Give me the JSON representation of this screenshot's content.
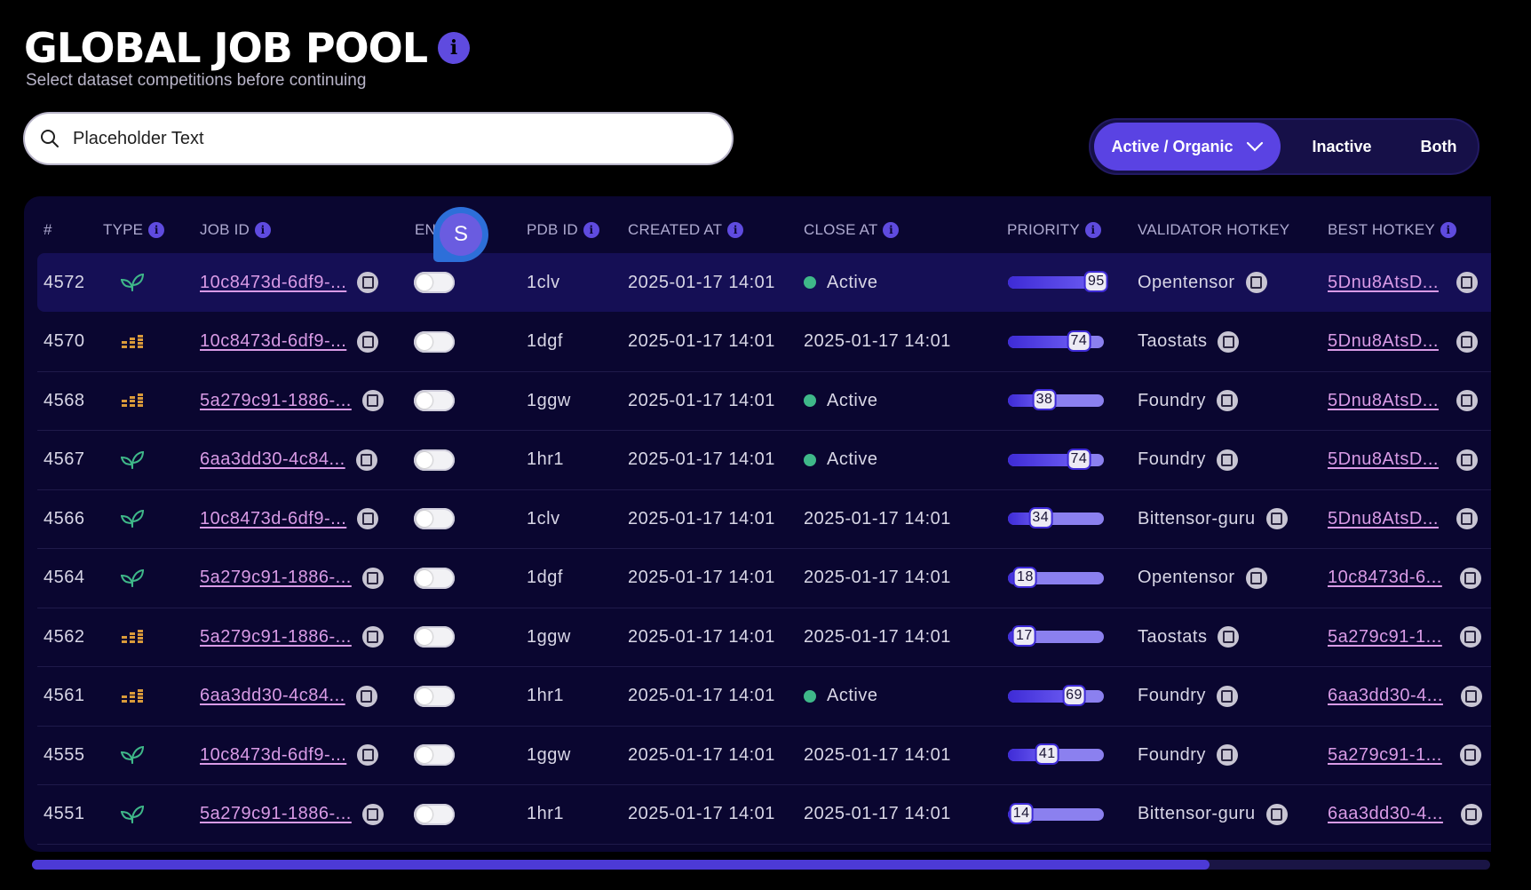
{
  "header": {
    "title": "GLOBAL JOB POOL",
    "subtitle": "Select dataset competitions before continuing"
  },
  "search": {
    "placeholder": "Placeholder Text",
    "value": ""
  },
  "filter": {
    "options": [
      "Active / Organic",
      "Inactive",
      "Both"
    ],
    "selected": "Active / Organic"
  },
  "table": {
    "columns": [
      "#",
      "TYPE",
      "JOB ID",
      "EN",
      "PDB ID",
      "CREATED AT",
      "CLOSE AT",
      "PRIORITY",
      "VALIDATOR HOTKEY",
      "BEST HOTKEY"
    ],
    "rows": [
      {
        "num": "4572",
        "type": "leaf-icon",
        "job_id": "10c8473d-6df9-...",
        "pdb": "1clv",
        "created": "2025-01-17 14:01",
        "close": "Active",
        "active": true,
        "priority": 95,
        "priority_label": "95",
        "validator": "Opentensor",
        "best": "5Dnu8AtsD..."
      },
      {
        "num": "4570",
        "type": "bars-icon",
        "job_id": "10c8473d-6df9-...",
        "pdb": "1dgf",
        "created": "2025-01-17 14:01",
        "close": "2025-01-17 14:01",
        "active": false,
        "priority": 74,
        "priority_label": "74",
        "validator": "Taostats",
        "best": "5Dnu8AtsD..."
      },
      {
        "num": "4568",
        "type": "bars-icon",
        "job_id": "5a279c91-1886-...",
        "pdb": "1ggw",
        "created": "2025-01-17 14:01",
        "close": "Active",
        "active": true,
        "priority": 38,
        "priority_label": "38",
        "validator": "Foundry",
        "best": "5Dnu8AtsD..."
      },
      {
        "num": "4567",
        "type": "leaf-icon",
        "job_id": "6aa3dd30-4c84...",
        "pdb": "1hr1",
        "created": "2025-01-17 14:01",
        "close": "Active",
        "active": true,
        "priority": 74,
        "priority_label": "74",
        "validator": "Foundry",
        "best": "5Dnu8AtsD..."
      },
      {
        "num": "4566",
        "type": "leaf-icon",
        "job_id": "10c8473d-6df9-...",
        "pdb": "1clv",
        "created": "2025-01-17 14:01",
        "close": "2025-01-17 14:01",
        "active": false,
        "priority": 34,
        "priority_label": "34",
        "validator": "Bittensor-guru",
        "best": "5Dnu8AtsD..."
      },
      {
        "num": "4564",
        "type": "leaf-icon",
        "job_id": "5a279c91-1886-...",
        "pdb": "1dgf",
        "created": "2025-01-17 14:01",
        "close": "2025-01-17 14:01",
        "active": false,
        "priority": 18,
        "priority_label": "18",
        "validator": "Opentensor",
        "best": "10c8473d-6..."
      },
      {
        "num": "4562",
        "type": "bars-icon",
        "job_id": "5a279c91-1886-...",
        "pdb": "1ggw",
        "created": "2025-01-17 14:01",
        "close": "2025-01-17 14:01",
        "active": false,
        "priority": 17,
        "priority_label": "17",
        "validator": "Taostats",
        "best": "5a279c91-1..."
      },
      {
        "num": "4561",
        "type": "bars-icon",
        "job_id": "6aa3dd30-4c84...",
        "pdb": "1hr1",
        "created": "2025-01-17 14:01",
        "close": "Active",
        "active": true,
        "priority": 69,
        "priority_label": "69",
        "validator": "Foundry",
        "best": "6aa3dd30-4..."
      },
      {
        "num": "4555",
        "type": "leaf-icon",
        "job_id": "10c8473d-6df9-...",
        "pdb": "1ggw",
        "created": "2025-01-17 14:01",
        "close": "2025-01-17 14:01",
        "active": false,
        "priority": 41,
        "priority_label": "41",
        "validator": "Foundry",
        "best": "5a279c91-1..."
      },
      {
        "num": "4551",
        "type": "leaf-icon",
        "job_id": "5a279c91-1886-...",
        "pdb": "1hr1",
        "created": "2025-01-17 14:01",
        "close": "2025-01-17 14:01",
        "active": false,
        "priority": 14,
        "priority_label": "14",
        "validator": "Bittensor-guru",
        "best": "6aa3dd30-4..."
      }
    ]
  },
  "avatar": {
    "initial": "S"
  },
  "colors": {
    "accent": "#5a43e3",
    "status_active": "#3fb889",
    "link": "#d99be6",
    "leaf": "#3fb889",
    "bars": "#d99a3a"
  }
}
